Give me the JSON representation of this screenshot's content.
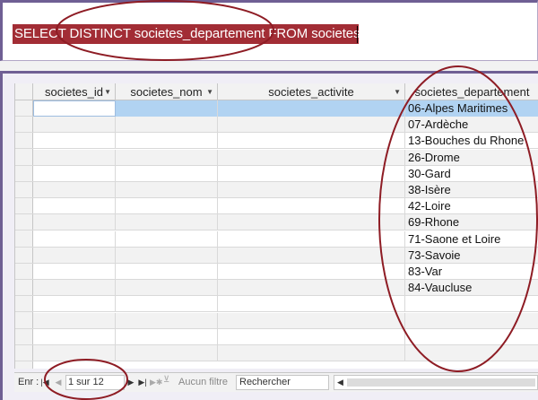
{
  "sql": {
    "query": "SELECT DISTINCT societes_departement FROM societes;"
  },
  "grid": {
    "columns": [
      {
        "label": "societes_id",
        "has_dropdown": true
      },
      {
        "label": "societes_nom",
        "has_dropdown": true
      },
      {
        "label": "societes_activite",
        "has_dropdown": true
      },
      {
        "label": "societes_departement",
        "has_dropdown": false
      }
    ],
    "rows": [
      "06-Alpes Maritimes",
      "07-Ardèche",
      "13-Bouches du Rhone",
      "26-Drome",
      "30-Gard",
      "38-Isère",
      "42-Loire",
      "69-Rhone",
      "71-Saone et Loire",
      "73-Savoie",
      "83-Var",
      "84-Vaucluse"
    ],
    "selected_row": 0
  },
  "status": {
    "record_label": "Enr :",
    "position": "1 sur 12",
    "filter_label": "Aucun filtre",
    "search_placeholder": "Rechercher"
  },
  "icons": {
    "first": "first-record-icon",
    "prev": "previous-record-icon",
    "next": "next-record-icon",
    "last": "last-record-icon",
    "new": "new-record-icon",
    "filter": "filter-icon",
    "scroll_left": "scroll-left-icon"
  },
  "colors": {
    "sql_highlight": "#a22d35",
    "selection": "#b1d3f2",
    "frame": "#6f5f94",
    "annotation": "#8e1c24"
  }
}
